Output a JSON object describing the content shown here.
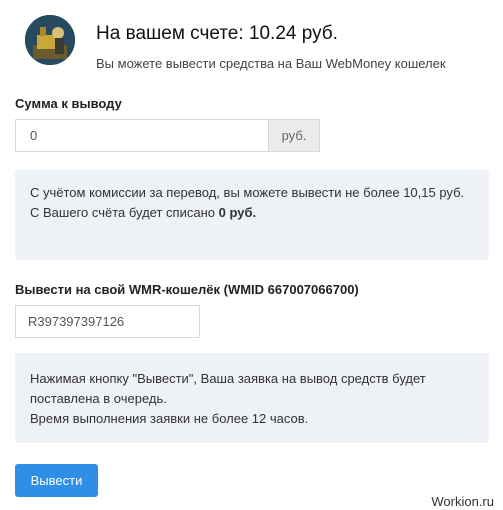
{
  "header": {
    "balance_title": "На вашем счете: 10.24 руб.",
    "balance_subtitle": "Вы можете вывести средства на Ваш WebMoney кошелек"
  },
  "amount": {
    "label": "Сумма к выводу",
    "value": "0",
    "currency_addon": "руб."
  },
  "commission_info": {
    "line1": "С учётом комиссии за перевод, вы можете вывести не более 10,15 руб.",
    "line2_prefix": "С Вашего счёта будет списано",
    "line2_amount": "0 руб."
  },
  "wallet": {
    "label": "Вывести на свой WMR-кошелёк (WMID 667007066700)",
    "value": "R397397397126"
  },
  "queue_info": {
    "line1": "Нажимая кнопку \"Вывести\", Ваша заявка на вывод средств будет поставлена в очередь.",
    "line2": "Время выполнения заявки не более 12 часов."
  },
  "actions": {
    "submit_label": "Вывести"
  },
  "watermark": "Workion.ru",
  "colors": {
    "accent": "#2f8fe6",
    "info_background": "#eef1f6"
  },
  "icons": {
    "avatar": "user-avatar-image"
  }
}
